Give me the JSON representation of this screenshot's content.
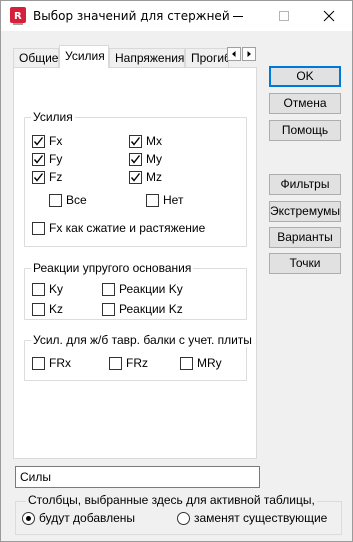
{
  "window": {
    "title": "Выбор значений для стержней"
  },
  "tabs": [
    "Общие",
    "Усилия",
    "Напряжения",
    "Прогиб"
  ],
  "active_tab": "Усилия",
  "forces": {
    "legend": "Усилия",
    "fx": "Fx",
    "fy": "Fy",
    "fz": "Fz",
    "mx": "Mx",
    "my": "My",
    "mz": "Mz",
    "all": "Все",
    "none": "Нет",
    "fx_compress": "Fx как сжатие и растяжение"
  },
  "elastic": {
    "legend": "Реакции упругого основания",
    "ky": "Ky",
    "kz": "Kz",
    "rky": "Реакции Ky",
    "rkz": "Реакции Kz"
  },
  "tbeam": {
    "legend": "Усил. для ж/б тавр. балки с учет. плиты",
    "frx": "FRx",
    "frz": "FRz",
    "mry": "MRy"
  },
  "buttons": {
    "ok": "OK",
    "cancel": "Отмена",
    "help": "Помощь",
    "filters": "Фильтры",
    "extremums": "Экстремумы",
    "variants": "Варианты",
    "points": "Точки"
  },
  "name_field": {
    "value": "Силы"
  },
  "columns_group": {
    "legend": "Столбцы, выбранные здесь для активной таблицы,",
    "add": "будут добавлены",
    "replace": "заменят существующие"
  },
  "colors": {
    "accent": "#0078d7",
    "icon_red": "#d6203b"
  }
}
